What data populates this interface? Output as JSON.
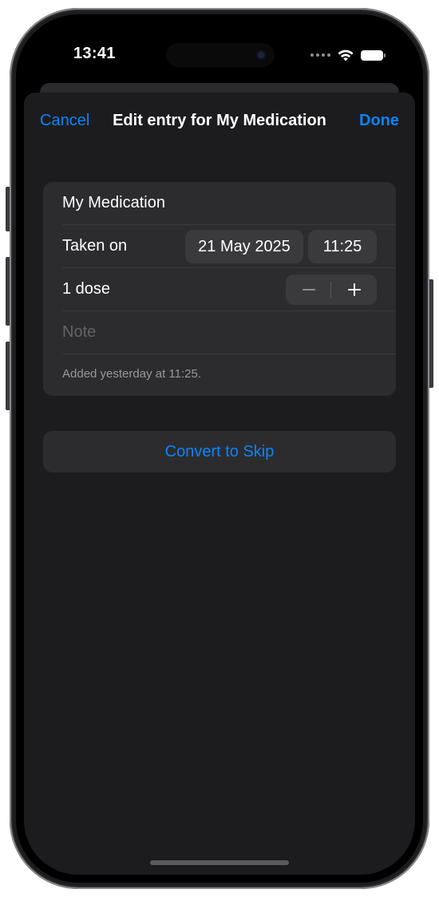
{
  "status_bar": {
    "time": "13:41",
    "icons": [
      "signal-dots-icon",
      "wifi-icon",
      "battery-icon"
    ]
  },
  "nav": {
    "cancel_label": "Cancel",
    "title": "Edit entry for My Medication",
    "done_label": "Done"
  },
  "entry": {
    "medication_name": "My Medication",
    "taken_on_label": "Taken on",
    "date_value": "21 May 2025",
    "time_value": "11:25",
    "dose_label": "1 dose",
    "note_placeholder": "Note",
    "footnote": "Added yesterday at 11:25."
  },
  "actions": {
    "convert_label": "Convert to Skip"
  },
  "colors": {
    "accent": "#0a84ff",
    "sheet_background": "#1c1c1e",
    "group_background": "#2c2c2e"
  }
}
